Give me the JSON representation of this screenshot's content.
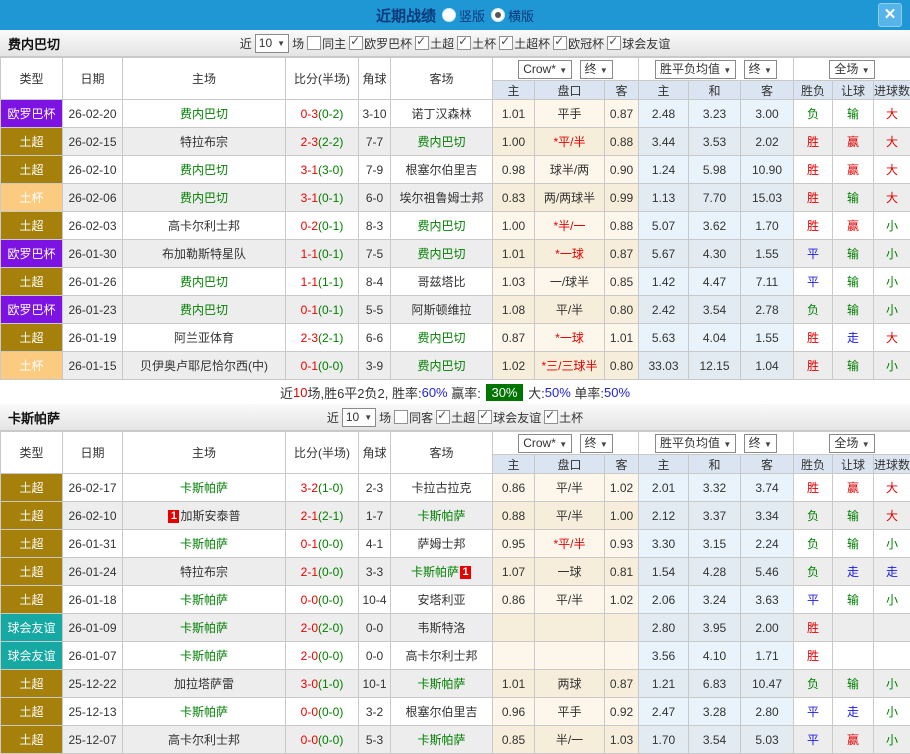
{
  "titlebar": {
    "title": "近期战绩",
    "options": [
      {
        "label": "竖版",
        "selected": false
      },
      {
        "label": "横版",
        "selected": true
      }
    ],
    "close_label": "✕"
  },
  "colors": {
    "topbar": "#1f97d5",
    "europa_badge": "#7d13e3",
    "super_badge": "#a5810b",
    "cup_badge": "#fbcc7f",
    "friendly_badge": "#16a8a2",
    "win_red": "#e60000",
    "lose_green": "#008000",
    "draw_blue": "#1a1ae6"
  },
  "table_header": {
    "type": "类型",
    "date": "日期",
    "home": "主场",
    "score": "比分(半场)",
    "corners": "角球",
    "away": "客场",
    "odds_dropdown": "Crow*",
    "final_dropdown": "终",
    "mean_dropdown": "胜平负均值",
    "final_dropdown2": "终",
    "fulltime_dropdown": "全场",
    "odds_home": "主",
    "odds_handicap": "盘口",
    "odds_away": "客",
    "mean_home": "主",
    "mean_draw": "和",
    "mean_away": "客",
    "result_wdl": "胜负",
    "result_handicap": "让球",
    "result_goals": "进球数"
  },
  "sections": [
    {
      "team": "费内巴切",
      "filter": {
        "prefix": "近",
        "count": "10",
        "suffix": "场",
        "same": {
          "label": "同主",
          "checked": false
        },
        "leagues": [
          {
            "label": "欧罗巴杯",
            "checked": true
          },
          {
            "label": "土超",
            "checked": true
          },
          {
            "label": "土杯",
            "checked": true
          },
          {
            "label": "土超杯",
            "checked": true
          },
          {
            "label": "欧冠杯",
            "checked": true
          },
          {
            "label": "球会友谊",
            "checked": true
          }
        ]
      },
      "rows": [
        {
          "league": "欧罗巴杯",
          "lg": "europa",
          "date": "26-02-20",
          "home": "费内巴切",
          "hf": true,
          "hc": "",
          "score": "0-3",
          "half": "(0-2)",
          "corners": "3-10",
          "away": "诺丁汉森林",
          "af": false,
          "ac": "",
          "o1": "1.01",
          "hcap": "平手",
          "hred": false,
          "o2": "0.87",
          "m1": "2.48",
          "m2": "3.23",
          "m3": "3.00",
          "r1": "负",
          "r1c": "g",
          "r2": "输",
          "r2c": "g",
          "r3": "大",
          "r3c": "r"
        },
        {
          "league": "土超",
          "lg": "super",
          "date": "26-02-15",
          "home": "特拉布宗",
          "hf": false,
          "hc": "",
          "score": "2-3",
          "half": "(2-2)",
          "corners": "7-7",
          "away": "费内巴切",
          "af": true,
          "ac": "",
          "o1": "1.00",
          "hcap": "*平/半",
          "hred": true,
          "o2": "0.88",
          "m1": "3.44",
          "m2": "3.53",
          "m3": "2.02",
          "r1": "胜",
          "r1c": "r",
          "r2": "赢",
          "r2c": "r",
          "r3": "大",
          "r3c": "r"
        },
        {
          "league": "土超",
          "lg": "super",
          "date": "26-02-10",
          "home": "费内巴切",
          "hf": true,
          "hc": "",
          "score": "3-1",
          "half": "(3-0)",
          "corners": "7-9",
          "away": "根塞尔伯里吉",
          "af": false,
          "ac": "",
          "o1": "0.98",
          "hcap": "球半/两",
          "hred": false,
          "o2": "0.90",
          "m1": "1.24",
          "m2": "5.98",
          "m3": "10.90",
          "r1": "胜",
          "r1c": "r",
          "r2": "赢",
          "r2c": "r",
          "r3": "大",
          "r3c": "r"
        },
        {
          "league": "土杯",
          "lg": "cup",
          "date": "26-02-06",
          "home": "费内巴切",
          "hf": true,
          "hc": "",
          "score": "3-1",
          "half": "(0-1)",
          "corners": "6-0",
          "away": "埃尔祖鲁姆士邦",
          "af": false,
          "ac": "",
          "o1": "0.83",
          "hcap": "两/两球半",
          "hred": false,
          "o2": "0.99",
          "m1": "1.13",
          "m2": "7.70",
          "m3": "15.03",
          "r1": "胜",
          "r1c": "r",
          "r2": "输",
          "r2c": "g",
          "r3": "大",
          "r3c": "r"
        },
        {
          "league": "土超",
          "lg": "super",
          "date": "26-02-03",
          "home": "高卡尔利士邦",
          "hf": false,
          "hc": "",
          "score": "0-2",
          "half": "(0-1)",
          "corners": "8-3",
          "away": "费内巴切",
          "af": true,
          "ac": "",
          "o1": "1.00",
          "hcap": "*半/一",
          "hred": true,
          "o2": "0.88",
          "m1": "5.07",
          "m2": "3.62",
          "m3": "1.70",
          "r1": "胜",
          "r1c": "r",
          "r2": "赢",
          "r2c": "r",
          "r3": "小",
          "r3c": "g"
        },
        {
          "league": "欧罗巴杯",
          "lg": "europa",
          "date": "26-01-30",
          "home": "布加勒斯特星队",
          "hf": false,
          "hc": "",
          "score": "1-1",
          "half": "(0-1)",
          "corners": "7-5",
          "away": "费内巴切",
          "af": true,
          "ac": "",
          "o1": "1.01",
          "hcap": "*一球",
          "hred": true,
          "o2": "0.87",
          "m1": "5.67",
          "m2": "4.30",
          "m3": "1.55",
          "r1": "平",
          "r1c": "b",
          "r2": "输",
          "r2c": "g",
          "r3": "小",
          "r3c": "g"
        },
        {
          "league": "土超",
          "lg": "super",
          "date": "26-01-26",
          "home": "费内巴切",
          "hf": true,
          "hc": "",
          "score": "1-1",
          "half": "(1-1)",
          "corners": "8-4",
          "away": "哥兹塔比",
          "af": false,
          "ac": "",
          "o1": "1.03",
          "hcap": "一/球半",
          "hred": false,
          "o2": "0.85",
          "m1": "1.42",
          "m2": "4.47",
          "m3": "7.11",
          "r1": "平",
          "r1c": "b",
          "r2": "输",
          "r2c": "g",
          "r3": "小",
          "r3c": "g"
        },
        {
          "league": "欧罗巴杯",
          "lg": "europa",
          "date": "26-01-23",
          "home": "费内巴切",
          "hf": true,
          "hc": "",
          "score": "0-1",
          "half": "(0-1)",
          "corners": "5-5",
          "away": "阿斯顿维拉",
          "af": false,
          "ac": "",
          "o1": "1.08",
          "hcap": "平/半",
          "hred": false,
          "o2": "0.80",
          "m1": "2.42",
          "m2": "3.54",
          "m3": "2.78",
          "r1": "负",
          "r1c": "g",
          "r2": "输",
          "r2c": "g",
          "r3": "小",
          "r3c": "g"
        },
        {
          "league": "土超",
          "lg": "super",
          "date": "26-01-19",
          "home": "阿兰亚体育",
          "hf": false,
          "hc": "",
          "score": "2-3",
          "half": "(2-1)",
          "corners": "6-6",
          "away": "费内巴切",
          "af": true,
          "ac": "",
          "o1": "0.87",
          "hcap": "*一球",
          "hred": true,
          "o2": "1.01",
          "m1": "5.63",
          "m2": "4.04",
          "m3": "1.55",
          "r1": "胜",
          "r1c": "r",
          "r2": "走",
          "r2c": "b",
          "r3": "大",
          "r3c": "r"
        },
        {
          "league": "土杯",
          "lg": "cup",
          "date": "26-01-15",
          "home": "贝伊奥卢耶尼恰尔西(中)",
          "hf": false,
          "hc": "",
          "score": "0-1",
          "half": "(0-0)",
          "corners": "3-9",
          "away": "费内巴切",
          "af": true,
          "ac": "",
          "o1": "1.02",
          "hcap": "*三/三球半",
          "hred": true,
          "o2": "0.80",
          "m1": "33.03",
          "m2": "12.15",
          "m3": "1.04",
          "r1": "胜",
          "r1c": "r",
          "r2": "输",
          "r2c": "g",
          "r3": "小",
          "r3c": "g"
        }
      ],
      "summary": {
        "segments": [
          {
            "text": "近",
            "c": ""
          },
          {
            "text": "10",
            "c": "red"
          },
          {
            "text": "场,胜6平2负2, 胜率:",
            "c": ""
          },
          {
            "text": "60%",
            "c": "blue"
          },
          {
            "text": " 赢率: ",
            "c": ""
          },
          {
            "text": "30%",
            "c": "badge"
          },
          {
            "text": " 大:",
            "c": ""
          },
          {
            "text": "50%",
            "c": "blue"
          },
          {
            "text": " 单率:",
            "c": ""
          },
          {
            "text": "50%",
            "c": "blue"
          }
        ]
      }
    },
    {
      "team": "卡斯帕萨",
      "filter": {
        "prefix": "近",
        "count": "10",
        "suffix": "场",
        "same": {
          "label": "同客",
          "checked": false
        },
        "leagues": [
          {
            "label": "土超",
            "checked": true
          },
          {
            "label": "球会友谊",
            "checked": true
          },
          {
            "label": "土杯",
            "checked": true
          }
        ]
      },
      "rows": [
        {
          "league": "土超",
          "lg": "super",
          "date": "26-02-17",
          "home": "卡斯帕萨",
          "hf": true,
          "hc": "",
          "score": "3-2",
          "half": "(1-0)",
          "corners": "2-3",
          "away": "卡拉古拉克",
          "af": false,
          "ac": "",
          "o1": "0.86",
          "hcap": "平/半",
          "hred": false,
          "o2": "1.02",
          "m1": "2.01",
          "m2": "3.32",
          "m3": "3.74",
          "r1": "胜",
          "r1c": "r",
          "r2": "赢",
          "r2c": "r",
          "r3": "大",
          "r3c": "r"
        },
        {
          "league": "土超",
          "lg": "super",
          "date": "26-02-10",
          "home": "加斯安泰普",
          "hf": false,
          "hc": "1",
          "score": "2-1",
          "half": "(2-1)",
          "corners": "1-7",
          "away": "卡斯帕萨",
          "af": true,
          "ac": "",
          "o1": "0.88",
          "hcap": "平/半",
          "hred": false,
          "o2": "1.00",
          "m1": "2.12",
          "m2": "3.37",
          "m3": "3.34",
          "r1": "负",
          "r1c": "g",
          "r2": "输",
          "r2c": "g",
          "r3": "大",
          "r3c": "r"
        },
        {
          "league": "土超",
          "lg": "super",
          "date": "26-01-31",
          "home": "卡斯帕萨",
          "hf": true,
          "hc": "",
          "score": "0-1",
          "half": "(0-0)",
          "corners": "4-1",
          "away": "萨姆士邦",
          "af": false,
          "ac": "",
          "o1": "0.95",
          "hcap": "*平/半",
          "hred": true,
          "o2": "0.93",
          "m1": "3.30",
          "m2": "3.15",
          "m3": "2.24",
          "r1": "负",
          "r1c": "g",
          "r2": "输",
          "r2c": "g",
          "r3": "小",
          "r3c": "g"
        },
        {
          "league": "土超",
          "lg": "super",
          "date": "26-01-24",
          "home": "特拉布宗",
          "hf": false,
          "hc": "",
          "score": "2-1",
          "half": "(0-0)",
          "corners": "3-3",
          "away": "卡斯帕萨",
          "af": true,
          "ac": "1",
          "o1": "1.07",
          "hcap": "一球",
          "hred": false,
          "o2": "0.81",
          "m1": "1.54",
          "m2": "4.28",
          "m3": "5.46",
          "r1": "负",
          "r1c": "g",
          "r2": "走",
          "r2c": "b",
          "r3": "走",
          "r3c": "b"
        },
        {
          "league": "土超",
          "lg": "super",
          "date": "26-01-18",
          "home": "卡斯帕萨",
          "hf": true,
          "hc": "",
          "score": "0-0",
          "half": "(0-0)",
          "corners": "10-4",
          "away": "安塔利亚",
          "af": false,
          "ac": "",
          "o1": "0.86",
          "hcap": "平/半",
          "hred": false,
          "o2": "1.02",
          "m1": "2.06",
          "m2": "3.24",
          "m3": "3.63",
          "r1": "平",
          "r1c": "b",
          "r2": "输",
          "r2c": "g",
          "r3": "小",
          "r3c": "g"
        },
        {
          "league": "球会友谊",
          "lg": "friendly",
          "date": "26-01-09",
          "home": "卡斯帕萨",
          "hf": true,
          "hc": "",
          "score": "2-0",
          "half": "(2-0)",
          "corners": "0-0",
          "away": "韦斯特洛",
          "af": false,
          "ac": "",
          "o1": "",
          "hcap": "",
          "hred": false,
          "o2": "",
          "m1": "2.80",
          "m2": "3.95",
          "m3": "2.00",
          "r1": "胜",
          "r1c": "r",
          "r2": "",
          "r2c": "",
          "r3": "",
          "r3c": ""
        },
        {
          "league": "球会友谊",
          "lg": "friendly",
          "date": "26-01-07",
          "home": "卡斯帕萨",
          "hf": true,
          "hc": "",
          "score": "2-0",
          "half": "(0-0)",
          "corners": "0-0",
          "away": "高卡尔利士邦",
          "af": false,
          "ac": "",
          "o1": "",
          "hcap": "",
          "hred": false,
          "o2": "",
          "m1": "3.56",
          "m2": "4.10",
          "m3": "1.71",
          "r1": "胜",
          "r1c": "r",
          "r2": "",
          "r2c": "",
          "r3": "",
          "r3c": ""
        },
        {
          "league": "土超",
          "lg": "super",
          "date": "25-12-22",
          "home": "加拉塔萨雷",
          "hf": false,
          "hc": "",
          "score": "3-0",
          "half": "(1-0)",
          "corners": "10-1",
          "away": "卡斯帕萨",
          "af": true,
          "ac": "",
          "o1": "1.01",
          "hcap": "两球",
          "hred": false,
          "o2": "0.87",
          "m1": "1.21",
          "m2": "6.83",
          "m3": "10.47",
          "r1": "负",
          "r1c": "g",
          "r2": "输",
          "r2c": "g",
          "r3": "小",
          "r3c": "g"
        },
        {
          "league": "土超",
          "lg": "super",
          "date": "25-12-13",
          "home": "卡斯帕萨",
          "hf": true,
          "hc": "",
          "score": "0-0",
          "half": "(0-0)",
          "corners": "3-2",
          "away": "根塞尔伯里吉",
          "af": false,
          "ac": "",
          "o1": "0.96",
          "hcap": "平手",
          "hred": false,
          "o2": "0.92",
          "m1": "2.47",
          "m2": "3.28",
          "m3": "2.80",
          "r1": "平",
          "r1c": "b",
          "r2": "走",
          "r2c": "b",
          "r3": "小",
          "r3c": "g"
        },
        {
          "league": "土超",
          "lg": "super",
          "date": "25-12-07",
          "home": "高卡尔利士邦",
          "hf": false,
          "hc": "",
          "score": "0-0",
          "half": "(0-0)",
          "corners": "5-3",
          "away": "卡斯帕萨",
          "af": true,
          "ac": "",
          "o1": "0.85",
          "hcap": "半/一",
          "hred": false,
          "o2": "1.03",
          "m1": "1.70",
          "m2": "3.54",
          "m3": "5.03",
          "r1": "平",
          "r1c": "b",
          "r2": "赢",
          "r2c": "r",
          "r3": "小",
          "r3c": "g"
        }
      ]
    }
  ]
}
